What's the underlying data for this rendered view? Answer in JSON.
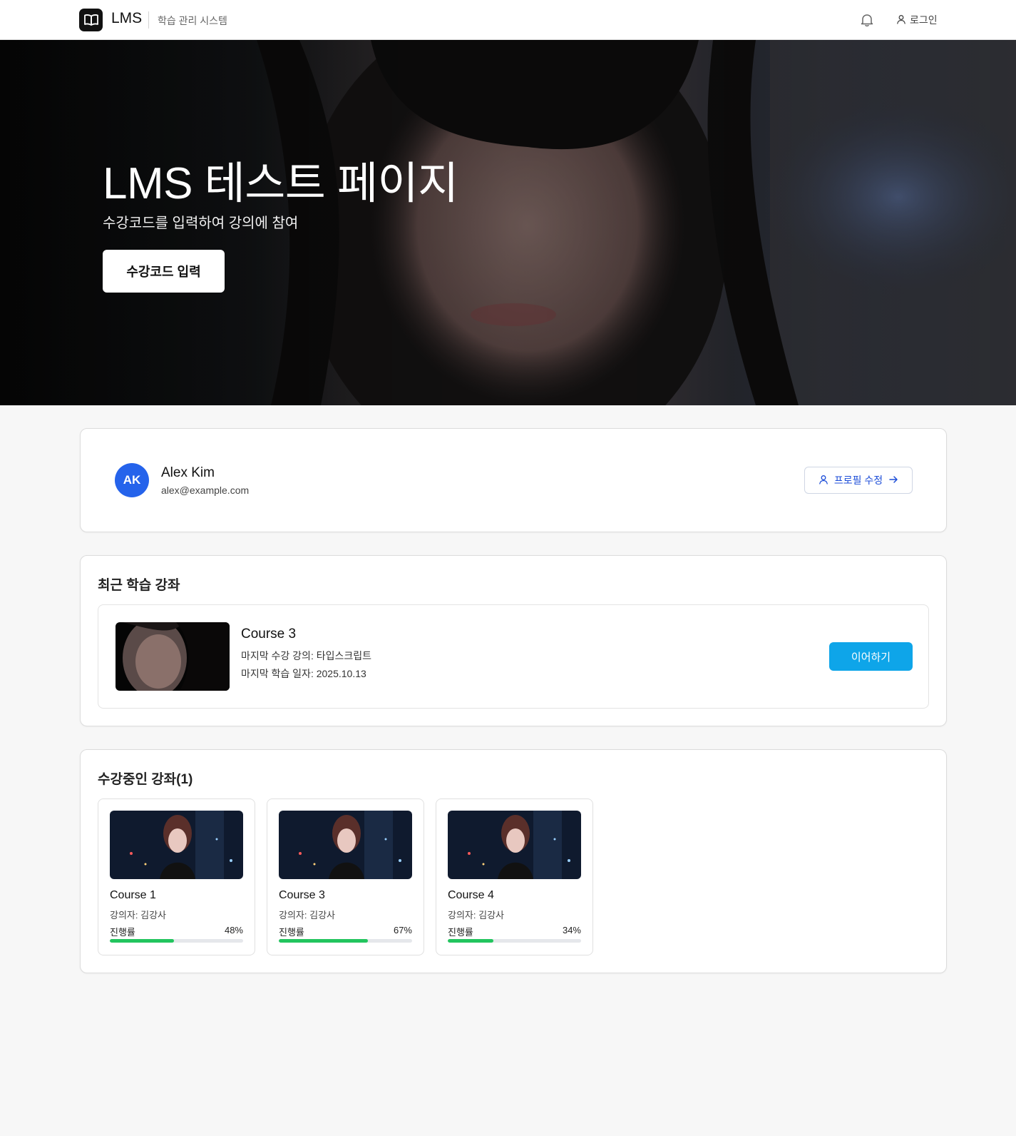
{
  "header": {
    "logo_text": "LMS",
    "subtitle": "학습 관리 시스템",
    "login_label": "로그인"
  },
  "hero": {
    "title": "LMS 테스트 페이지",
    "subtitle": "수강코드를 입력하여 강의에 참여",
    "button_label": "수강코드 입력"
  },
  "profile": {
    "initials": "AK",
    "name": "Alex Kim",
    "email": "alex@example.com",
    "edit_label": "프로필 수정",
    "avatar_color": "#2563eb"
  },
  "recent": {
    "title": "최근 학습 강좌",
    "course": "Course 3",
    "last_lecture": "마지막 수강 강의: 타입스크립트",
    "last_date": "마지막 학습 일자: 2025.10.13",
    "continue_label": "이어하기",
    "button_color": "#0ea5e9"
  },
  "enrolled": {
    "title": "수강중인 강좌(1)",
    "progress_label": "진행률",
    "courses": [
      {
        "name": "Course 1",
        "instructor": "강의자: 김강사",
        "progress": 48,
        "progress_text": "48%"
      },
      {
        "name": "Course 3",
        "instructor": "강의자: 김강사",
        "progress": 67,
        "progress_text": "67%"
      },
      {
        "name": "Course 4",
        "instructor": "강의자: 김강사",
        "progress": 34,
        "progress_text": "34%"
      }
    ],
    "progress_color": "#22c55e"
  }
}
